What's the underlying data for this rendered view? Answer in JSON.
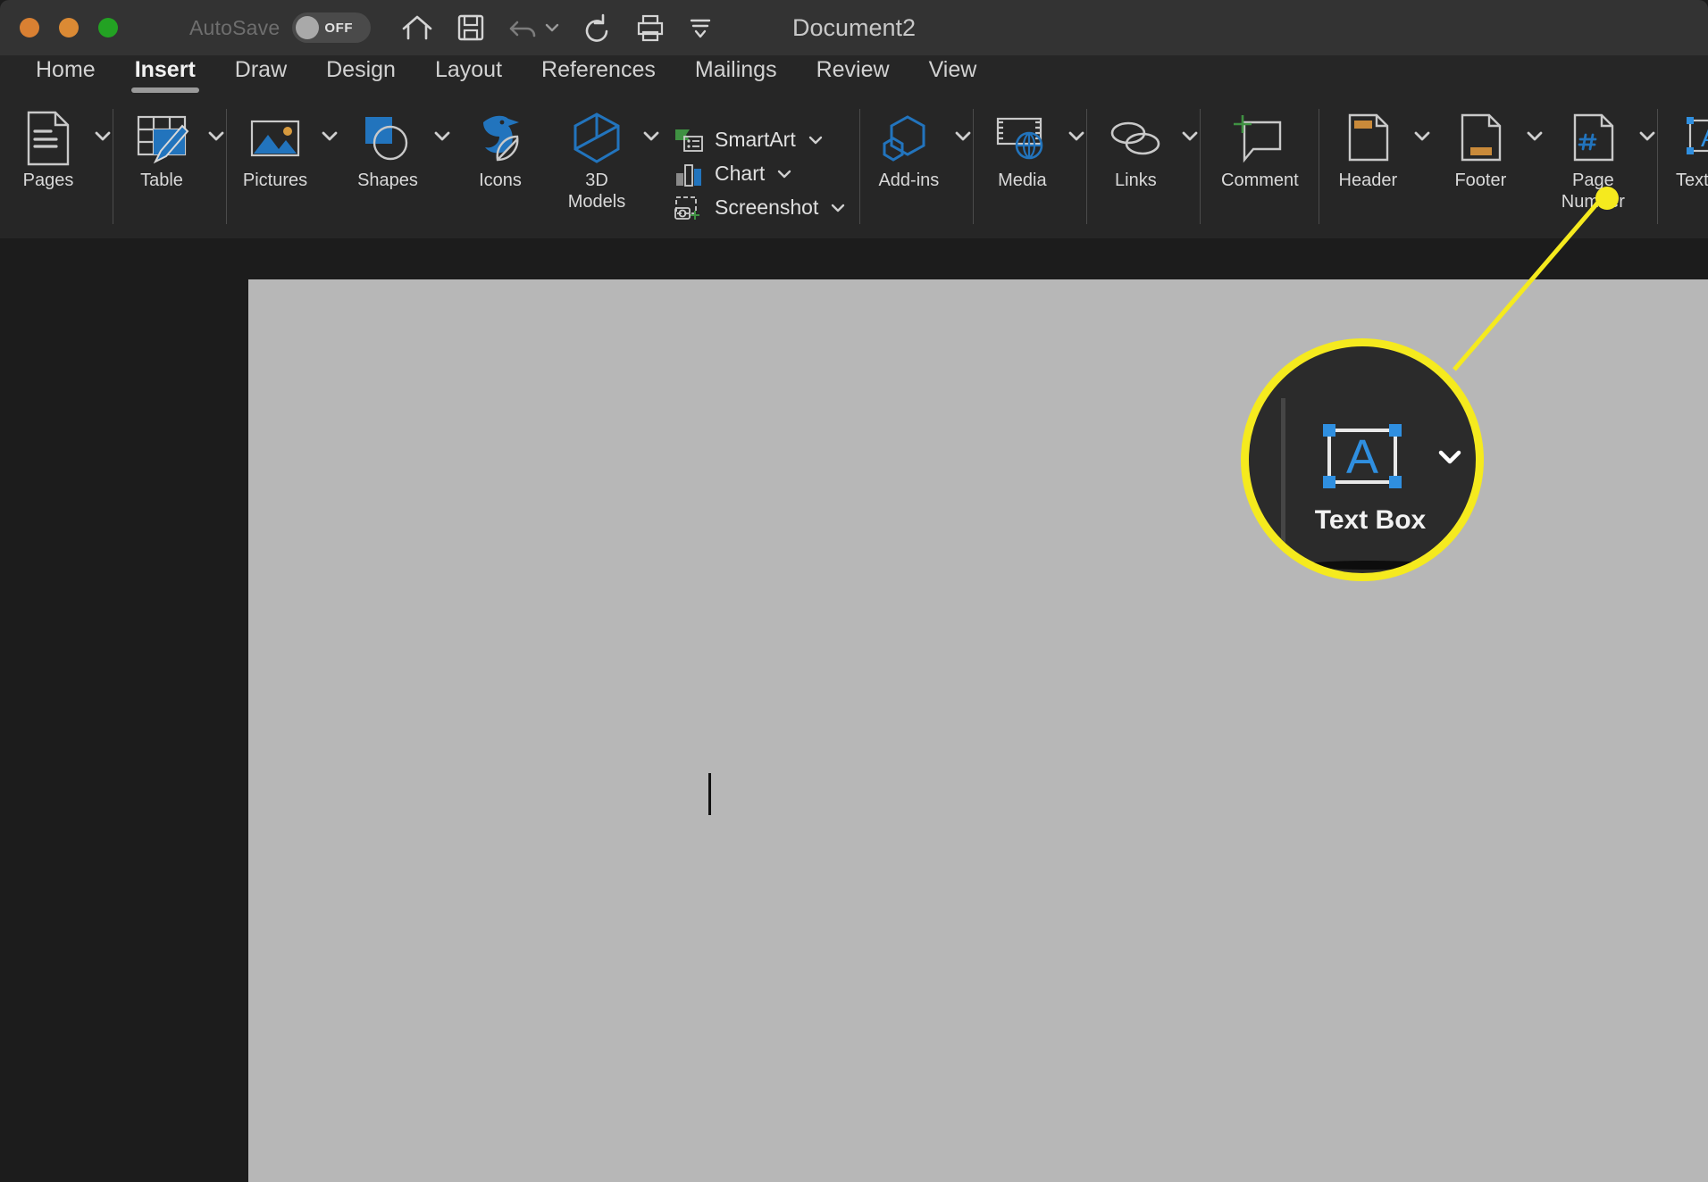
{
  "window": {
    "title": "Document2",
    "traffic_lights": [
      "close",
      "minimize",
      "maximize"
    ],
    "autosave": {
      "label": "AutoSave",
      "state": "OFF"
    },
    "quick_access": [
      {
        "name": "home-icon",
        "label": "Home"
      },
      {
        "name": "save-icon",
        "label": "Save"
      },
      {
        "name": "undo-icon",
        "label": "Undo"
      },
      {
        "name": "undo-dropdown-icon",
        "label": "Undo options"
      },
      {
        "name": "redo-icon",
        "label": "Redo"
      },
      {
        "name": "print-icon",
        "label": "Print"
      },
      {
        "name": "customize-toolbar-icon",
        "label": "Customize Quick Access Toolbar"
      }
    ]
  },
  "tabs": [
    {
      "label": "Home",
      "active": false
    },
    {
      "label": "Insert",
      "active": true
    },
    {
      "label": "Draw",
      "active": false
    },
    {
      "label": "Design",
      "active": false
    },
    {
      "label": "Layout",
      "active": false
    },
    {
      "label": "References",
      "active": false
    },
    {
      "label": "Mailings",
      "active": false
    },
    {
      "label": "Review",
      "active": false
    },
    {
      "label": "View",
      "active": false
    }
  ],
  "ribbon": {
    "buttons": {
      "pages": "Pages",
      "table": "Table",
      "pictures": "Pictures",
      "shapes": "Shapes",
      "icons": "Icons",
      "models3d": "3D\nModels",
      "smartart": "SmartArt",
      "chart": "Chart",
      "screenshot": "Screenshot",
      "addins": "Add-ins",
      "media": "Media",
      "links": "Links",
      "comment": "Comment",
      "header": "Header",
      "footer": "Footer",
      "page_number": "Page\nNumber",
      "text_box": "Text Box"
    }
  },
  "callout": {
    "magnified_label": "Text Box",
    "highlight_color": "#f5ea1e"
  },
  "document": {
    "page_color": "#b7b7b7",
    "cursor_visible": true
  }
}
